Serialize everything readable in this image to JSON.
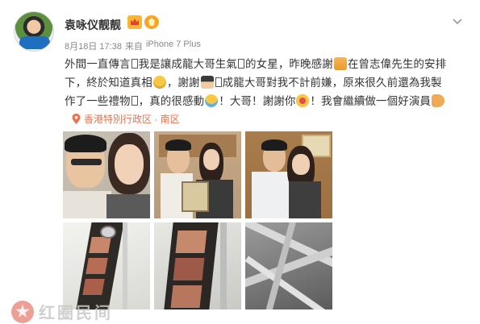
{
  "post": {
    "username": "袁咏仪靓靓",
    "meta": {
      "date": "8月18日 17:38",
      "source_prefix": "来自",
      "source": "iPhone 7 Plus"
    },
    "content": {
      "line1_a": "外間一直傳言",
      "line1_b": "我是讓成龍大哥生氣",
      "line1_c": "的女星，昨晚感謝",
      "line1_d": "在曾志偉先生的安排",
      "line2_a": "下，終於知道真相",
      "line2_b": "，謝謝",
      "line2_c": "成龍大哥對我不計前嫌，原來很久前還為我製",
      "line3_a": "作了一些禮物",
      "line3_b": "，真的很感動",
      "line3_c": "！大哥！謝謝你",
      "line3_d": "！我會繼續做一個好演員"
    },
    "location": "香港特別行政区 · 南区",
    "photos": [
      {
        "description_icon": "photo-selfie"
      },
      {
        "description_icon": "photo-gift"
      },
      {
        "description_icon": "photo-pose"
      },
      {
        "description_icon": "photo-film-strip"
      },
      {
        "description_icon": "photo-film-closeup"
      },
      {
        "description_icon": "photo-film-reels"
      }
    ],
    "emoji": [
      "pray",
      "sad",
      "bow",
      "cry",
      "love",
      "muscle"
    ]
  },
  "watermark": {
    "text": "红圈民间"
  },
  "colors": {
    "link_orange": "#eb7350",
    "meta_gray": "#888888",
    "text": "#333333"
  }
}
